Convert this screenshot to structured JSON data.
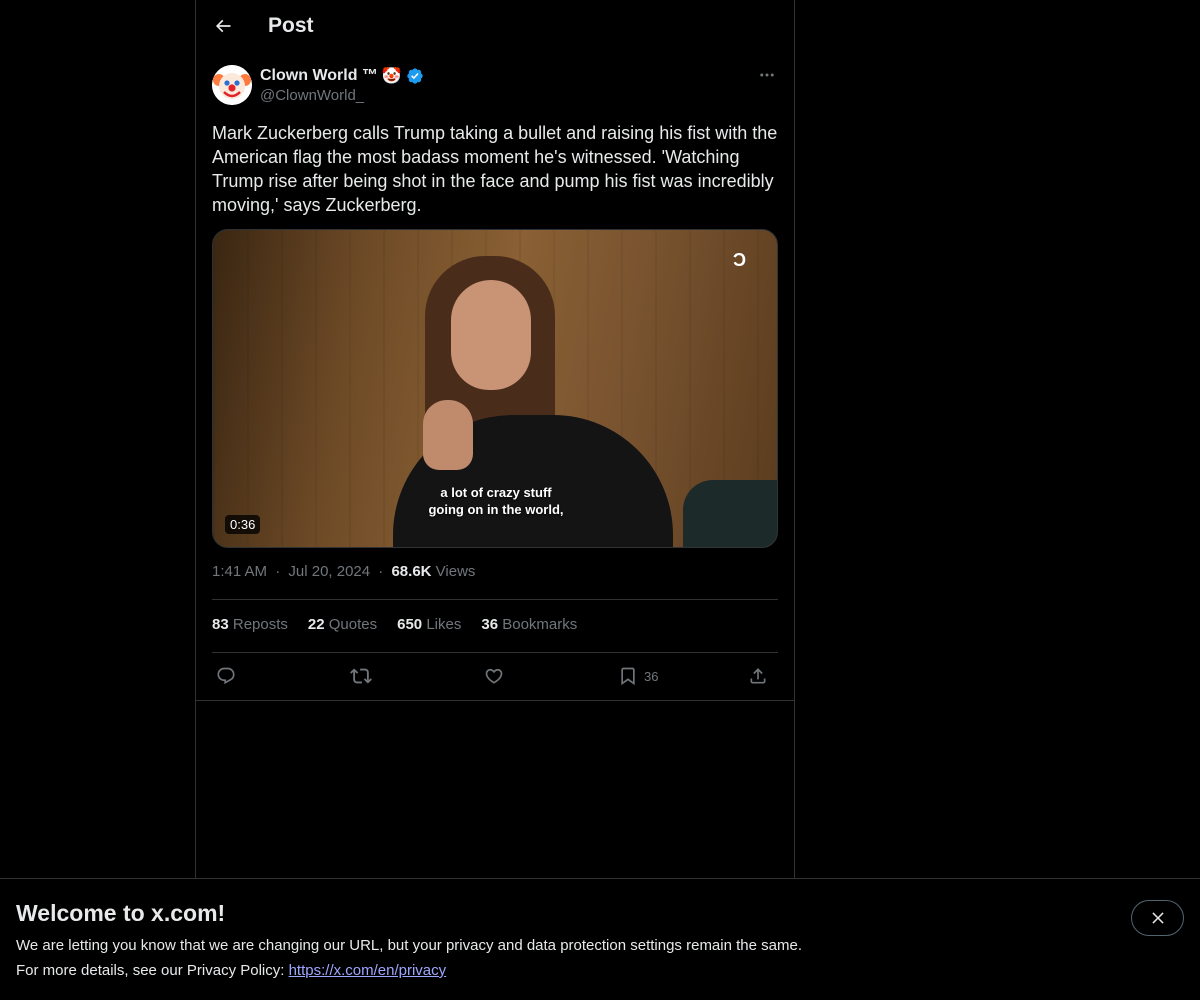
{
  "header": {
    "title": "Post",
    "back_icon": "arrow-left-icon"
  },
  "post": {
    "author": {
      "display_name": "Clown World ™",
      "name_emoji": "🤡",
      "handle": "@ClownWorld_",
      "verified": true,
      "verified_color": "#1d9bf0"
    },
    "text": "Mark Zuckerberg calls Trump taking a bullet and raising his fist with the American flag the most badass moment he's witnessed. 'Watching Trump rise after being shot in the face and pump his fist was incredibly moving,' says Zuckerberg.",
    "media": {
      "caption_line1": "a lot of crazy stuff",
      "caption_line2": "going on in the world,",
      "duration": "0:36",
      "watermark": "Ͻ"
    },
    "meta": {
      "time": "1:41 AM",
      "separator": "·",
      "date": "Jul 20, 2024",
      "views_count": "68.6K",
      "views_label": "Views"
    },
    "stats": {
      "reposts_count": "83",
      "reposts_label": "Reposts",
      "quotes_count": "22",
      "quotes_label": "Quotes",
      "likes_count": "650",
      "likes_label": "Likes",
      "bookmarks_count": "36",
      "bookmarks_label": "Bookmarks"
    },
    "actions": {
      "bookmark_count": "36"
    }
  },
  "banner": {
    "title": "Welcome to x.com!",
    "line1": "We are letting you know that we are changing our URL, but your privacy and data protection settings remain the same.",
    "line2_prefix": "For more details, see our Privacy Policy: ",
    "link_text": "https://x.com/en/privacy"
  },
  "colors": {
    "background": "#000000",
    "text_primary": "#e7e9ea",
    "text_secondary": "#71767b",
    "border": "#2f3336",
    "link": "#9ea6ff"
  }
}
